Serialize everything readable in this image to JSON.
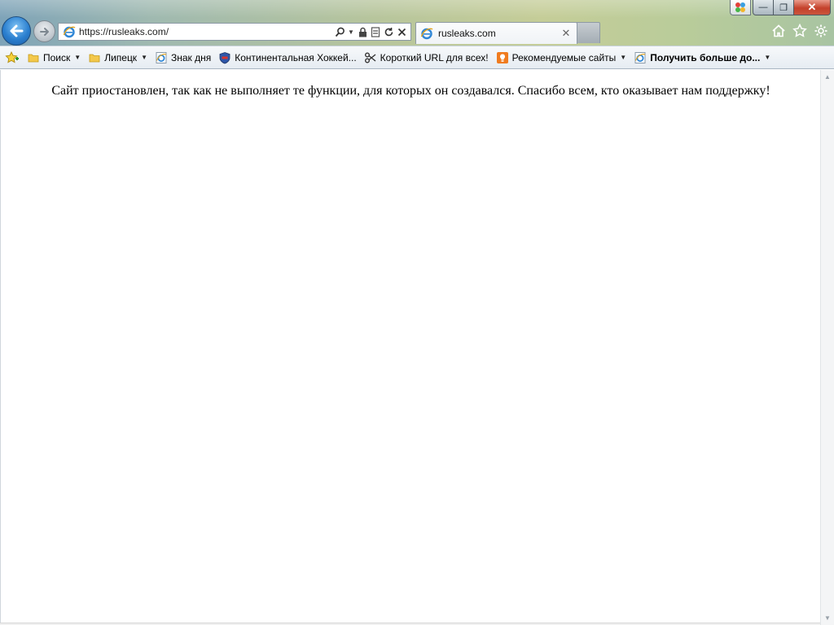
{
  "browser": {
    "address": {
      "url": "https://rusleaks.com/"
    },
    "tab": {
      "title": "rusleaks.com"
    },
    "caption": {
      "close_glyph": "✕",
      "minimize_glyph": "—",
      "maximize_glyph": "❐"
    }
  },
  "favorites": {
    "items": [
      {
        "label": "Поиск",
        "icon": "folder-icon",
        "has_dropdown": true
      },
      {
        "label": "Липецк",
        "icon": "folder-icon",
        "has_dropdown": true
      },
      {
        "label": "Знак дня",
        "icon": "ie-page-icon",
        "has_dropdown": false
      },
      {
        "label": "Континентальная Хоккей...",
        "icon": "khl-shield-icon",
        "has_dropdown": false
      },
      {
        "label": "Короткий URL для всех!",
        "icon": "scissors-icon",
        "has_dropdown": false
      },
      {
        "label": "Рекомендуемые сайты",
        "icon": "suggested-sites-icon",
        "has_dropdown": true
      },
      {
        "label": "Получить больше до...",
        "icon": "ie-page-icon",
        "has_dropdown": true,
        "bold": true
      }
    ]
  },
  "page": {
    "notice": "Сайт приостановлен, так как не выполняет те функции, для которых он создавался. Спасибо всем, кто оказывает нам поддержку!"
  },
  "colors": {
    "accent_blue": "#2b7fcf",
    "close_red": "#c4412b",
    "favbar_bg": "#eef2f6"
  }
}
